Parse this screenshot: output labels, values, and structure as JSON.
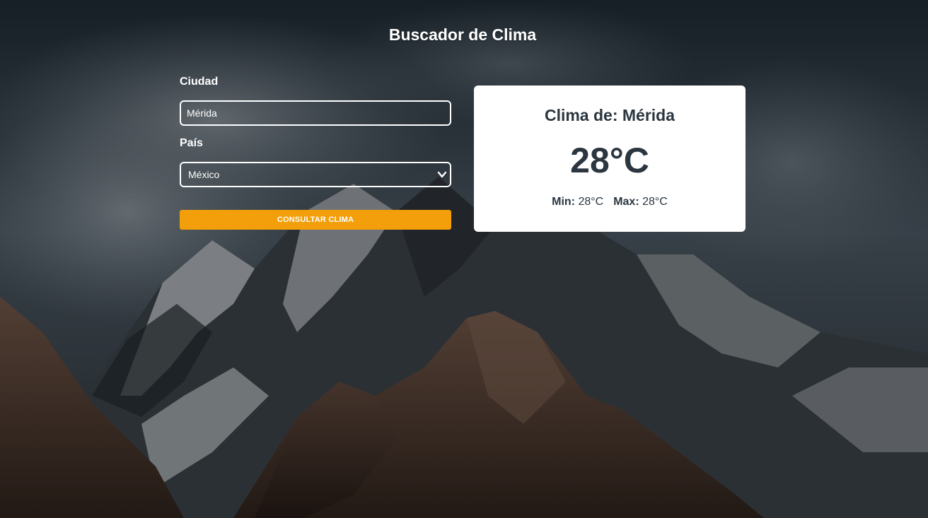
{
  "page": {
    "title": "Buscador de Clima"
  },
  "form": {
    "city_label": "Ciudad",
    "city_value": "Mérida",
    "country_label": "País",
    "country_selected": "México",
    "submit_label": "Consultar Clima"
  },
  "weather": {
    "title_prefix": "Clima de: ",
    "city": "Mérida",
    "temp": "28°C",
    "min_label": "Min:",
    "min_value": "28°C",
    "max_label": "Max:",
    "max_value": "28°C"
  },
  "icons": {
    "select_arrow": "chevron-down-icon"
  },
  "colors": {
    "accent": "#f29f0b",
    "card_bg": "#ffffff",
    "card_text": "#2b3640",
    "text_on_dark": "#ffffff"
  }
}
